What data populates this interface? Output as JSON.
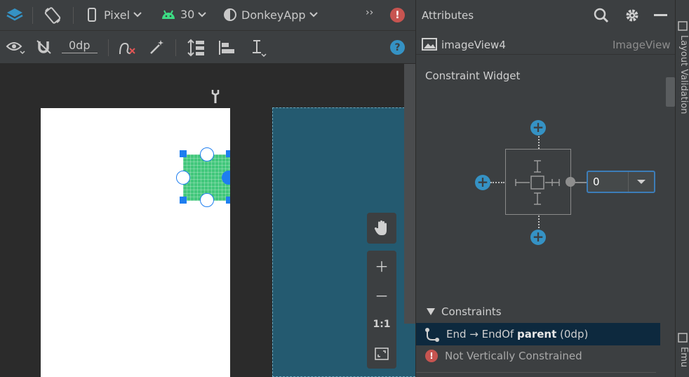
{
  "toolbar": {
    "device": "Pixel",
    "api_level": "30",
    "theme": "DonkeyApp",
    "overflow": "››",
    "margin_value": "0dp"
  },
  "attributes": {
    "title": "Attributes",
    "component_name": "imageView4",
    "component_type": "ImageView",
    "section_constraint_widget": "Constraint Widget",
    "end_margin_value": "0",
    "section_constraints": "Constraints",
    "constraint_end": {
      "prefix": "End → EndOf ",
      "target": "parent",
      "suffix": " (0dp)"
    },
    "warning": "Not Vertically Constrained"
  },
  "sidebar": {
    "layout_validation": "Layout Validation",
    "emulator": "Emu"
  },
  "icons": {
    "layers": "layers-icon",
    "rotate": "rotate-icon",
    "phone": "phone-icon",
    "android": "android-icon",
    "theme": "theme-icon",
    "error": "error-icon",
    "eye": "eye-icon",
    "magnet": "magnet-icon",
    "clear_constraints": "clear-constraints-icon",
    "infer": "magic-wand-icon",
    "pack": "pack-icon",
    "align": "align-icon",
    "guidelines": "guidelines-icon",
    "help": "help-icon",
    "search": "search-icon",
    "gear": "gear-icon",
    "minimize": "minimize-icon",
    "image": "image-icon",
    "pan": "hand-icon",
    "zoom_in": "zoom-in-icon",
    "zoom_out": "zoom-out-icon",
    "zoom_actual": "actual-size-icon",
    "zoom_fit": "fit-screen-icon",
    "wrench": "wrench-icon",
    "constraint": "constraint-icon"
  },
  "zoom": {
    "actual_label": "1:1"
  },
  "colors": {
    "accent_blue": "#3592c4",
    "widget_green": "#41c77b",
    "blueprint": "#245a70",
    "error_red": "#c75450",
    "selection": "#0d293e"
  }
}
